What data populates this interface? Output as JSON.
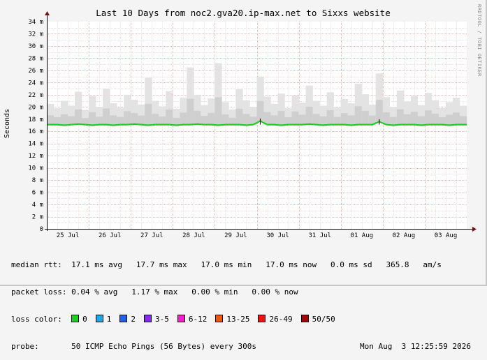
{
  "chart_data": {
    "type": "line",
    "title": "Last 10 Days from noc2.gva20.ip-max.net to Sixxs website",
    "ylabel": "Seconds",
    "xlabel": "",
    "ylim": [
      0,
      34
    ],
    "y_unit_suffix": "m",
    "yticks": [
      0,
      2,
      4,
      6,
      8,
      10,
      12,
      14,
      16,
      18,
      20,
      22,
      24,
      26,
      28,
      30,
      32,
      34
    ],
    "yticklabels": [
      "0",
      "2 m",
      "4 m",
      "6 m",
      "8 m",
      "10 m",
      "12 m",
      "14 m",
      "16 m",
      "18 m",
      "20 m",
      "22 m",
      "24 m",
      "26 m",
      "28 m",
      "30 m",
      "32 m",
      "34 m"
    ],
    "xticklabels": [
      "25 Jul",
      "26 Jul",
      "27 Jul",
      "28 Jul",
      "29 Jul",
      "30 Jul",
      "31 Jul",
      "01 Aug",
      "02 Aug",
      "03 Aug"
    ],
    "grid": true,
    "series": [
      {
        "name": "median rtt",
        "color": "#22cc22",
        "baseline_ms": 17.1,
        "values": [
          17.1,
          17.1,
          17.0,
          17.1,
          17.2,
          17.1,
          17.0,
          17.1,
          17.1,
          17.0,
          17.1,
          17.1,
          17.2,
          17.1,
          17.0,
          17.1,
          17.1,
          17.1,
          17.0,
          17.1,
          17.1,
          17.2,
          17.1,
          17.1,
          17.0,
          17.1,
          17.1,
          17.1,
          17.0,
          17.1,
          17.7,
          17.1,
          17.1,
          17.0,
          17.1,
          17.1,
          17.1,
          17.2,
          17.1,
          17.0,
          17.1,
          17.1,
          17.1,
          17.0,
          17.1,
          17.1,
          17.1,
          17.6,
          17.1,
          17.0,
          17.1,
          17.1,
          17.1,
          17.0,
          17.1,
          17.1,
          17.1,
          17.0,
          17.1,
          17.1
        ]
      }
    ],
    "smoke_upper_ms": [
      20.5,
      19.8,
      21.0,
      20.2,
      22.5,
      19.5,
      21.8,
      20.0,
      23.0,
      20.6,
      19.9,
      22.0,
      21.2,
      20.4,
      24.8,
      21.0,
      20.1,
      22.6,
      19.7,
      21.5,
      26.5,
      22.0,
      20.3,
      21.4,
      27.2,
      20.8,
      19.6,
      22.9,
      21.1,
      20.0,
      25.0,
      21.7,
      20.5,
      22.2,
      19.8,
      21.9,
      20.7,
      23.5,
      21.0,
      20.2,
      22.4,
      19.9,
      21.3,
      20.6,
      23.8,
      22.1,
      20.4,
      25.5,
      21.6,
      20.0,
      22.7,
      20.9,
      21.8,
      20.3,
      22.3,
      21.1,
      19.8,
      20.8,
      21.5,
      20.2
    ]
  },
  "watermark": "RRDTOOL / TOBI OETIKER",
  "legend": {
    "median_rtt": {
      "label": "median rtt:",
      "text": "17.1 ms avg   17.7 ms max   17.0 ms min   17.0 ms now   0.0 ms sd   365.8   am/s"
    },
    "packet_loss": {
      "label": "packet loss:",
      "text": "0.04 % avg   1.17 % max   0.00 % min   0.00 % now"
    },
    "loss_color": {
      "label": "loss color:",
      "items": [
        {
          "label": "0",
          "color": "#22cc22"
        },
        {
          "label": "1",
          "color": "#1ea7e8"
        },
        {
          "label": "2",
          "color": "#2060e8"
        },
        {
          "label": "3-5",
          "color": "#8a2be2"
        },
        {
          "label": "6-12",
          "color": "#ee22cc"
        },
        {
          "label": "13-25",
          "color": "#ee5511"
        },
        {
          "label": "26-49",
          "color": "#ee1111"
        },
        {
          "label": "50/50",
          "color": "#9a0a0a"
        }
      ]
    },
    "probe": {
      "label": "probe:",
      "text": "50 ICMP Echo Pings (56 Bytes) every 300s",
      "timestamp": "Mon Aug  3 12:25:59 2026"
    }
  }
}
